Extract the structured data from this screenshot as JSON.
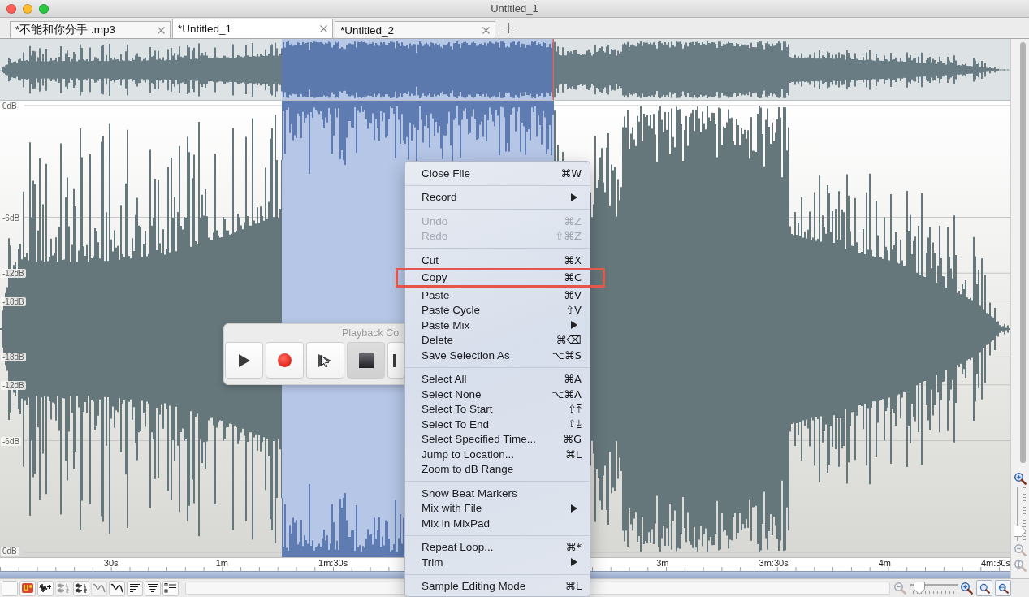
{
  "window": {
    "title": "Untitled_1"
  },
  "tabs": [
    {
      "label": "*不能和你分手 .mp3",
      "selected": false
    },
    {
      "label": "*Untitled_1",
      "selected": true
    },
    {
      "label": "*Untitled_2",
      "selected": false
    }
  ],
  "waveform": {
    "db_labels": [
      "0dB",
      "-6dB",
      "-12dB",
      "-18dB",
      "-18dB",
      "-12dB",
      "-6dB",
      "0dB"
    ]
  },
  "timeline": {
    "left_labels": [
      "30s",
      "1m",
      "1m:30s"
    ],
    "right_labels": [
      "3m",
      "3m:30s",
      "4m",
      "4m:30s"
    ]
  },
  "vertical_zoom": {
    "level": 0.1
  },
  "toolbar": {
    "tools": [
      {
        "kind": "blank",
        "disabled": false
      },
      {
        "kind": "logo",
        "disabled": false
      },
      {
        "kind": "waveform-add",
        "disabled": false
      },
      {
        "kind": "stereo",
        "disabled": true
      },
      {
        "kind": "stereo",
        "disabled": false
      },
      {
        "kind": "squiggle",
        "disabled": true
      },
      {
        "kind": "squiggle",
        "disabled": false
      },
      {
        "kind": "lines-left",
        "disabled": false
      },
      {
        "kind": "lines-center",
        "disabled": false
      },
      {
        "kind": "list",
        "disabled": false
      }
    ],
    "horizontal_zoom": {
      "level": 0.1
    }
  },
  "playback_control": {
    "title": "Playback Co",
    "buttons": [
      {
        "kind": "play",
        "pressed": false
      },
      {
        "kind": "record",
        "pressed": false
      },
      {
        "kind": "play-cursor",
        "pressed": false
      },
      {
        "kind": "stop",
        "pressed": true
      },
      {
        "kind": "skip",
        "pressed": false
      }
    ]
  },
  "context_menu": {
    "groups": [
      [
        {
          "label": "Close File",
          "shortcut": "⌘W",
          "kind": "action",
          "disabled": false,
          "highlighted": false
        }
      ],
      [
        {
          "label": "Record",
          "kind": "submenu",
          "disabled": false,
          "highlighted": false
        }
      ],
      [
        {
          "label": "Undo",
          "shortcut": "⌘Z",
          "kind": "action",
          "disabled": true,
          "highlighted": false
        },
        {
          "label": "Redo",
          "shortcut": "⇧⌘Z",
          "kind": "action",
          "disabled": true,
          "highlighted": false
        }
      ],
      [
        {
          "label": "Cut",
          "shortcut": "⌘X",
          "kind": "action",
          "disabled": false,
          "highlighted": false
        },
        {
          "label": "Copy",
          "shortcut": "⌘C",
          "kind": "action",
          "disabled": false,
          "highlighted": true
        },
        {
          "label": "Paste",
          "shortcut": "⌘V",
          "kind": "action",
          "disabled": false,
          "highlighted": false
        },
        {
          "label": "Paste Cycle",
          "shortcut": "⇧V",
          "kind": "action",
          "disabled": false,
          "highlighted": false
        },
        {
          "label": "Paste Mix",
          "kind": "submenu",
          "disabled": false,
          "highlighted": false
        },
        {
          "label": "Delete",
          "shortcut": "⌘⌫",
          "kind": "action",
          "disabled": false,
          "highlighted": false
        },
        {
          "label": "Save Selection As",
          "shortcut": "⌥⌘S",
          "kind": "action",
          "disabled": false,
          "highlighted": false
        }
      ],
      [
        {
          "label": "Select All",
          "shortcut": "⌘A",
          "kind": "action",
          "disabled": false,
          "highlighted": false
        },
        {
          "label": "Select None",
          "shortcut": "⌥⌘A",
          "kind": "action",
          "disabled": false,
          "highlighted": false
        },
        {
          "label": "Select To Start",
          "shortcut": "⇧⤒",
          "kind": "action",
          "disabled": false,
          "highlighted": false
        },
        {
          "label": "Select To End",
          "shortcut": "⇧⤓",
          "kind": "action",
          "disabled": false,
          "highlighted": false
        },
        {
          "label": "Select Specified Time...",
          "shortcut": "⌘G",
          "kind": "action",
          "disabled": false,
          "highlighted": false
        },
        {
          "label": "Jump to Location...",
          "shortcut": "⌘L",
          "kind": "action",
          "disabled": false,
          "highlighted": false
        },
        {
          "label": "Zoom to dB Range",
          "kind": "action",
          "disabled": false,
          "highlighted": false
        }
      ],
      [
        {
          "label": "Show Beat Markers",
          "kind": "action",
          "disabled": false,
          "highlighted": false
        },
        {
          "label": "Mix with File",
          "kind": "submenu",
          "disabled": false,
          "highlighted": false
        },
        {
          "label": "Mix in MixPad",
          "kind": "action",
          "disabled": false,
          "highlighted": false
        }
      ],
      [
        {
          "label": "Repeat Loop...",
          "shortcut": "⌘*",
          "kind": "action",
          "disabled": false,
          "highlighted": false
        },
        {
          "label": "Trim",
          "kind": "submenu",
          "disabled": false,
          "highlighted": false
        }
      ],
      [
        {
          "label": "Sample Editing Mode",
          "shortcut": "⌘L",
          "kind": "action",
          "disabled": false,
          "highlighted": false
        }
      ]
    ]
  }
}
